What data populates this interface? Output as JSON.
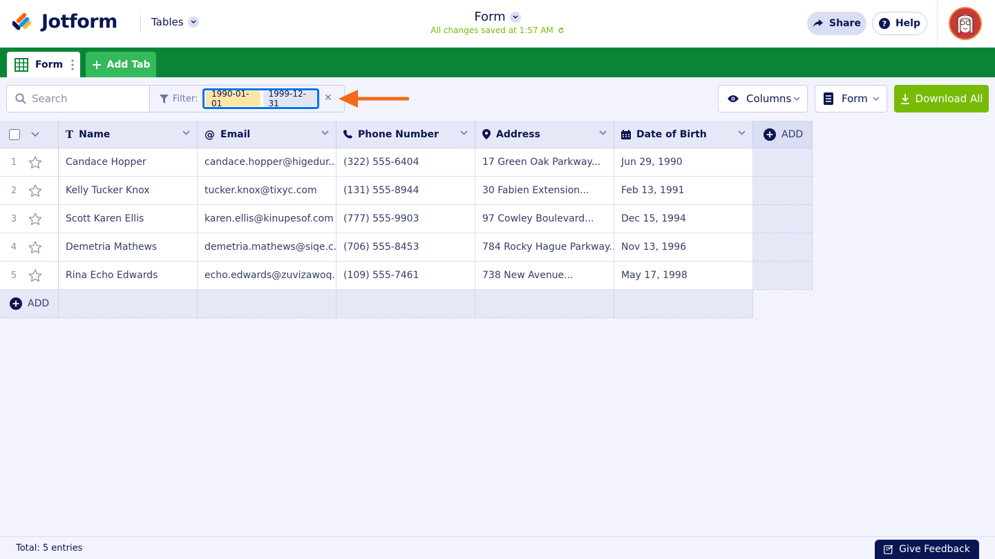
{
  "header": {
    "logo_text": "Jotform",
    "app_menu_label": "Tables",
    "form_title": "Form",
    "save_status": "All changes saved at 1:57 AM",
    "share_label": "Share",
    "help_label": "Help"
  },
  "tabs": {
    "active_tab": "Form",
    "add_tab_label": "Add Tab"
  },
  "toolbar": {
    "search_placeholder": "Search",
    "filter_label": "Filter:",
    "filter_values": [
      "1990-01-01",
      "1999-12-31"
    ],
    "columns_label": "Columns",
    "view_label": "Form",
    "download_label": "Download All"
  },
  "table": {
    "columns": [
      {
        "label": "Name",
        "icon": "text-type-icon"
      },
      {
        "label": "Email",
        "icon": "at-icon"
      },
      {
        "label": "Phone Number",
        "icon": "phone-icon"
      },
      {
        "label": "Address",
        "icon": "map-pin-icon"
      },
      {
        "label": "Date of Birth",
        "icon": "calendar-icon"
      }
    ],
    "add_column_label": "ADD",
    "add_row_label": "ADD",
    "rows": [
      {
        "num": "1",
        "cells": [
          "Candace Hopper",
          "candace.hopper@higedur...",
          "(322) 555-6404",
          "17 Green Oak Parkway...",
          "Jun 29, 1990"
        ]
      },
      {
        "num": "2",
        "cells": [
          "Kelly Tucker Knox",
          "tucker.knox@tixyc.com",
          "(131) 555-8944",
          "30 Fabien Extension...",
          "Feb 13, 1991"
        ]
      },
      {
        "num": "3",
        "cells": [
          "Scott Karen Ellis",
          "karen.ellis@kinupesof.com",
          "(777) 555-9903",
          "97 Cowley Boulevard...",
          "Dec 15, 1994"
        ]
      },
      {
        "num": "4",
        "cells": [
          "Demetria Mathews",
          "demetria.mathews@siqe.c...",
          "(706) 555-8453",
          "784 Rocky Hague Parkway...",
          "Nov 13, 1996"
        ]
      },
      {
        "num": "5",
        "cells": [
          "Rina Echo Edwards",
          "echo.edwards@zuvizawoq...",
          "(109) 555-7461",
          "738 New Avenue...",
          "May 17, 1998"
        ]
      }
    ]
  },
  "footer": {
    "total_text": "Total: 5 entries",
    "feedback_label": "Give Feedback"
  },
  "colors": {
    "brand_green": "#0a8536",
    "accent_lime": "#78bb07",
    "navy": "#0a1551",
    "highlight_blue": "#0075e3",
    "annotation_arrow": "#f26a17"
  }
}
